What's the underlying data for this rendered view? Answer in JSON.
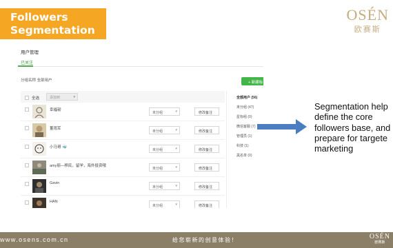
{
  "slide": {
    "title": "Followers Segmentation",
    "brand_name": "OSÉN",
    "brand_cn": "欧赛斯",
    "caption_lines": [
      "Segmentation help",
      "define the core",
      "followers base, and",
      "prepare for targete",
      "marketing"
    ],
    "footer_url": "www.osens.com.cn",
    "footer_slogan": "给您崭新的创意体验！",
    "footer_brand": "OSÉN",
    "footer_brand_cn": "欧赛斯",
    "accent_color": "#f5a623",
    "footer_color": "#8b7f67",
    "arrow_color": "#4a7ec1"
  },
  "screenshot": {
    "page_title": "用户管理",
    "active_tab": "已关注",
    "group_line": "分组名称  全部用户",
    "new_button": "+ 新建标",
    "select_all_label": "全选",
    "batch_placeholder": "添加到",
    "users": [
      {
        "name": "幸福韧",
        "group": "未分组",
        "remark": "修改备注"
      },
      {
        "name": "董雨军",
        "group": "未分组",
        "remark": "修改备注"
      },
      {
        "name": "小马哥 🐳",
        "group": "未分组",
        "remark": "修改备注"
      },
      {
        "name": "amy丽—移民，留学，海外投资哦",
        "group": "未分组",
        "remark": "修改备注"
      },
      {
        "name": "Gavin",
        "group": "未分组",
        "remark": "修改备注"
      },
      {
        "name": "HAN",
        "group": "未分组",
        "remark": "修改备注"
      }
    ],
    "sidebar_groups": [
      "全部用户 (56)",
      "未分组 (47)",
      "星标组 (0)",
      "微信客服 (7)",
      "管理员 (1)",
      "科技 (1)",
      "黑名单 (0)"
    ]
  }
}
